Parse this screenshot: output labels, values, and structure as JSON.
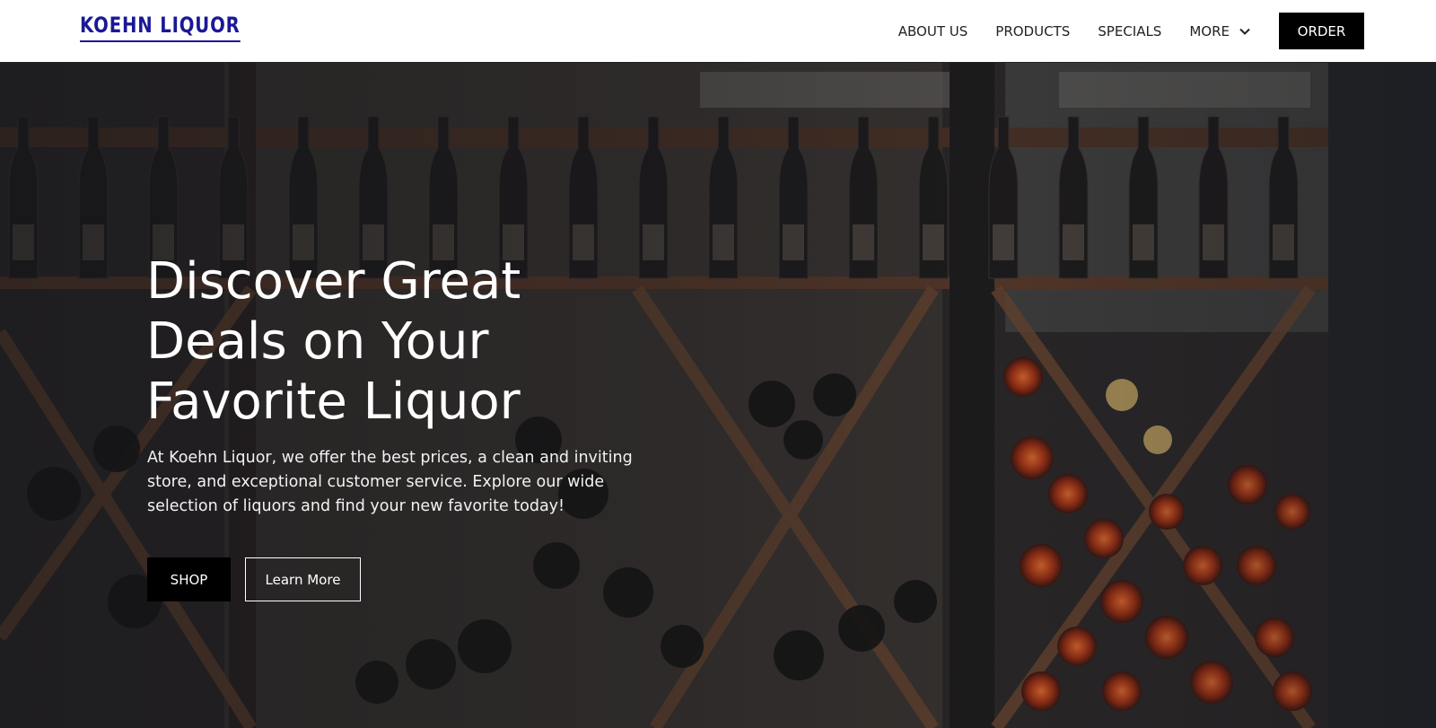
{
  "brand": {
    "logo_text": "KOEHN LIQUOR",
    "color": "#1b1896"
  },
  "nav": {
    "items": [
      {
        "label": "ABOUT US"
      },
      {
        "label": "PRODUCTS"
      },
      {
        "label": "SPECIALS"
      },
      {
        "label": "MORE",
        "icon": "chevron-down-icon"
      }
    ],
    "order_label": "ORDER"
  },
  "hero": {
    "background_image": "wine bottles on wooden racks",
    "headline": "Discover Great Deals on Your Favorite Liquor",
    "description": "At Koehn Liquor, we offer the best prices, a clean and inviting store, and exceptional customer service. Explore our wide selection of liquors and find your new favorite today!",
    "primary_button": "SHOP",
    "secondary_button": "Learn More"
  },
  "colors": {
    "accent": "#000000",
    "header_bg": "#ffffff",
    "hero_text": "#ffffff"
  }
}
